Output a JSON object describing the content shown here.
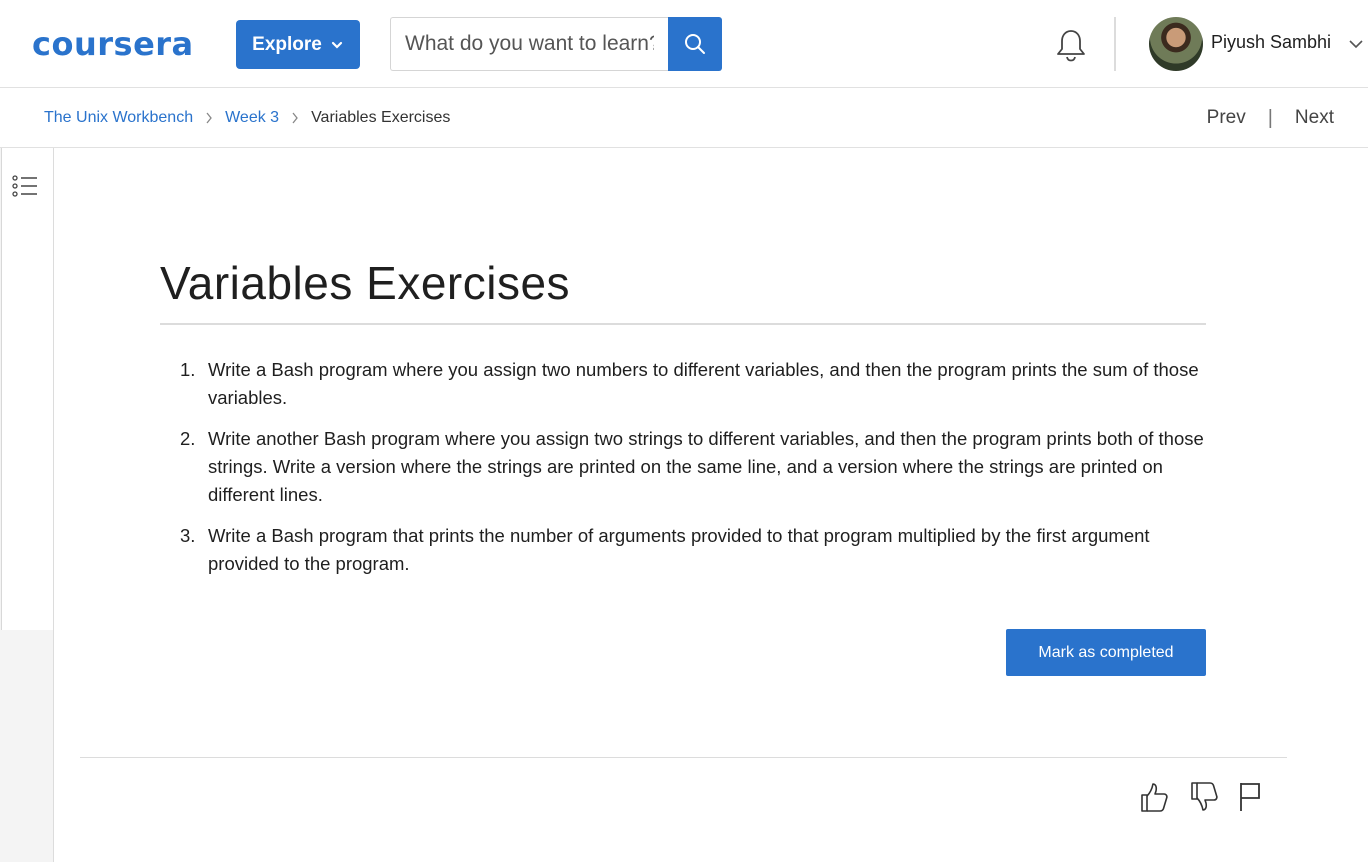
{
  "header": {
    "logo_text": "coursera",
    "explore_label": "Explore",
    "search_placeholder": "What do you want to learn?",
    "user_name": "Piyush Sambhi",
    "brand_color": "#2a73cc"
  },
  "breadcrumb": {
    "items": [
      "The Unix Workbench",
      "Week 3"
    ],
    "current": "Variables Exercises",
    "prev_label": "Prev",
    "next_label": "Next",
    "separator": "|"
  },
  "main": {
    "title": "Variables Exercises",
    "exercises": [
      {
        "num": "1.",
        "text": "Write a Bash program where you assign two numbers to different variables, and then the program prints the sum of those variables."
      },
      {
        "num": "2.",
        "text": "Write another Bash program where you assign two strings to different variables, and then the program prints both of those strings. Write a version where the strings are printed on the same line, and a version where the strings are printed on different lines."
      },
      {
        "num": "3.",
        "text": "Write a Bash program that prints the number of arguments provided to that program multiplied by the first argument provided to the program."
      }
    ],
    "complete_button": "Mark as completed"
  },
  "icons": {
    "toc": "list-icon",
    "like": "thumbs-up-icon",
    "dislike": "thumbs-down-icon",
    "flag": "flag-icon",
    "bell": "bell-icon",
    "search": "search-icon"
  }
}
